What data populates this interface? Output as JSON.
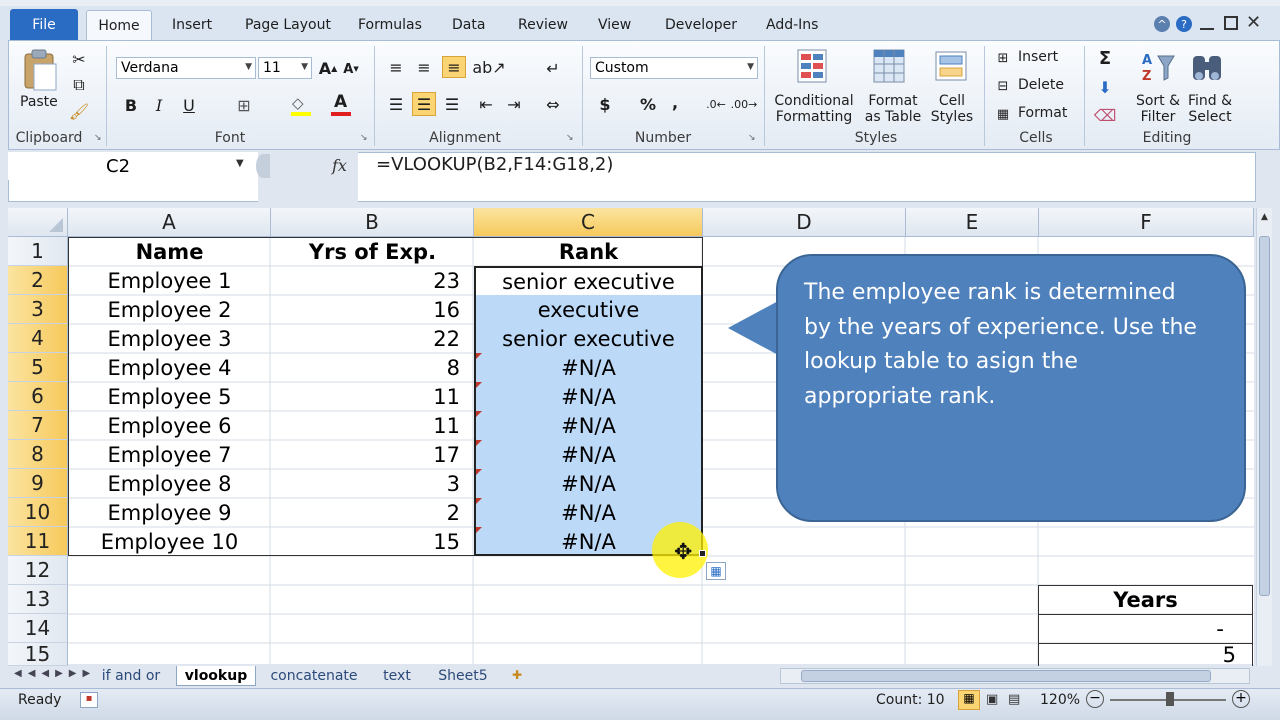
{
  "ribbon": {
    "file_tab": "File",
    "tabs": [
      "Home",
      "Insert",
      "Page Layout",
      "Formulas",
      "Data",
      "Review",
      "View",
      "Developer",
      "Add-Ins"
    ],
    "clipboard": {
      "paste": "Paste",
      "label": "Clipboard"
    },
    "font": {
      "name": "Verdana",
      "size": "11",
      "label": "Font"
    },
    "alignment": {
      "label": "Alignment"
    },
    "number": {
      "format": "Custom",
      "label": "Number",
      "currency": "$",
      "percent": "%",
      "comma": ","
    },
    "styles": {
      "conditional": [
        "Conditional",
        "Formatting"
      ],
      "format_table": [
        "Format",
        "as Table"
      ],
      "cell_styles": [
        "Cell",
        "Styles"
      ],
      "label": "Styles"
    },
    "cells": {
      "insert": "Insert",
      "delete": "Delete",
      "format": "Format",
      "label": "Cells"
    },
    "editing": {
      "sort": [
        "Sort &",
        "Filter"
      ],
      "find": [
        "Find &",
        "Select"
      ],
      "label": "Editing",
      "sigma": "Σ"
    }
  },
  "formula_bar": {
    "name_box": "C2",
    "fx": "fx",
    "formula": "=VLOOKUP(B2,F14:G18,2)"
  },
  "grid": {
    "columns": [
      "A",
      "B",
      "C",
      "D",
      "E",
      "F"
    ],
    "selected_column": "C",
    "row_numbers": [
      "1",
      "2",
      "3",
      "4",
      "5",
      "6",
      "7",
      "8",
      "9",
      "10",
      "11",
      "12",
      "13",
      "14",
      "15"
    ],
    "header_row": [
      "Name",
      "Yrs of Exp.",
      "Rank"
    ],
    "rows": [
      [
        "Employee 1",
        "23",
        "senior executive"
      ],
      [
        "Employee 2",
        "16",
        "executive"
      ],
      [
        "Employee 3",
        "22",
        "senior executive"
      ],
      [
        "Employee 4",
        "8",
        "#N/A"
      ],
      [
        "Employee 5",
        "11",
        "#N/A"
      ],
      [
        "Employee 6",
        "11",
        "#N/A"
      ],
      [
        "Employee 7",
        "17",
        "#N/A"
      ],
      [
        "Employee 8",
        "3",
        "#N/A"
      ],
      [
        "Employee 9",
        "2",
        "#N/A"
      ],
      [
        "Employee 10",
        "15",
        "#N/A"
      ]
    ],
    "lookup_header": "Years",
    "lookup_values": [
      "-",
      "5"
    ]
  },
  "callout": {
    "lines": [
      "The employee rank is determined",
      "by the years of experience. Use the",
      "lookup table to asign the",
      "appropriate rank."
    ]
  },
  "sheet_tabs": {
    "tabs": [
      "if and or",
      "vlookup",
      "concatenate",
      "text",
      "Sheet5"
    ],
    "active": "vlookup"
  },
  "status_bar": {
    "ready": "Ready",
    "count": "Count: 10",
    "zoom": "120%"
  },
  "colors": {
    "selection": "#bcd9f7",
    "callout": "#4f81bd",
    "file_tab": "#2a6bc4",
    "header_selected": "#f6c95b"
  }
}
